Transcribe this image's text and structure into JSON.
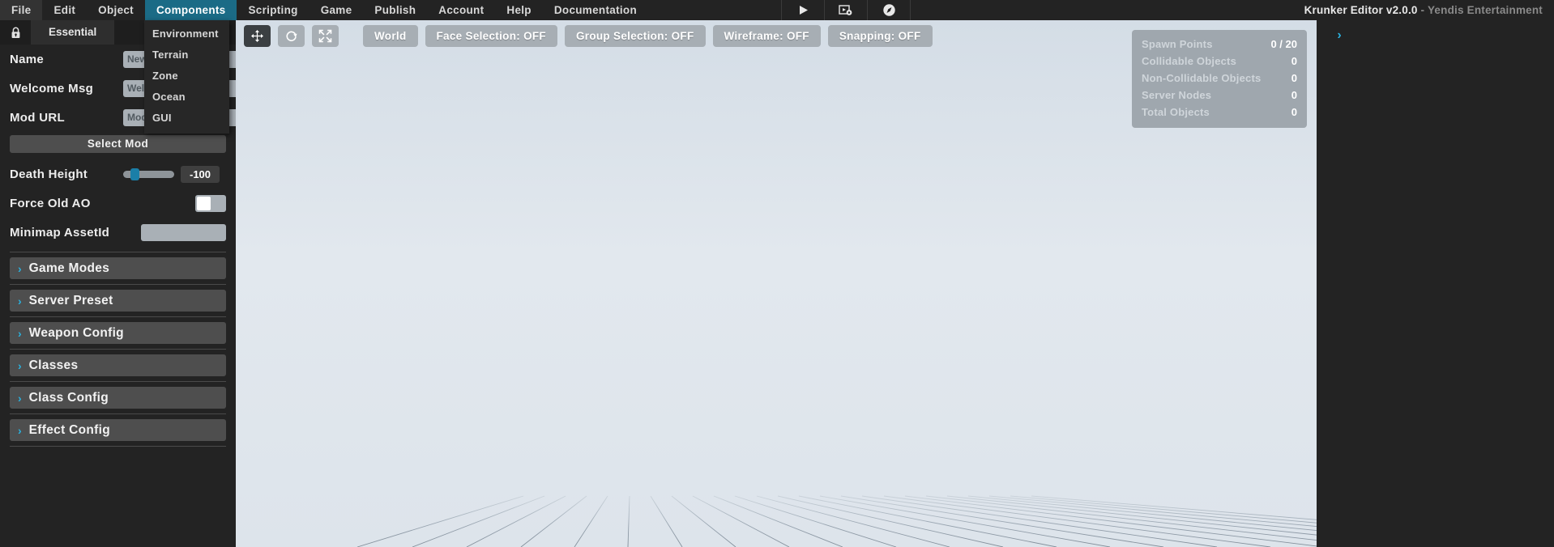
{
  "window": {
    "title": "Krunker Editor v2.0.0",
    "title_sub": " - Yendis Entertainment"
  },
  "menubar": {
    "items": [
      {
        "label": "File",
        "active": false
      },
      {
        "label": "Edit",
        "active": false
      },
      {
        "label": "Object",
        "active": false
      },
      {
        "label": "Components",
        "active": true
      },
      {
        "label": "Scripting",
        "active": false
      },
      {
        "label": "Game",
        "active": false
      },
      {
        "label": "Publish",
        "active": false
      },
      {
        "label": "Account",
        "active": false
      },
      {
        "label": "Help",
        "active": false
      },
      {
        "label": "Documentation",
        "active": false
      }
    ],
    "icons": [
      {
        "name": "play-icon",
        "title": "Play"
      },
      {
        "name": "record-settings-icon",
        "title": "Record Settings"
      },
      {
        "name": "compass-icon",
        "title": "Navigation"
      }
    ]
  },
  "dropdown": {
    "owner": "Components",
    "items": [
      {
        "label": "Environment"
      },
      {
        "label": "Terrain"
      },
      {
        "label": "Zone"
      },
      {
        "label": "Ocean"
      },
      {
        "label": "GUI"
      }
    ]
  },
  "left_panel": {
    "lock_icon": "lock-icon",
    "tab_label": "Essential",
    "fields": [
      {
        "label": "Name",
        "value": "",
        "placeholder": "New Map"
      },
      {
        "label": "Welcome Msg",
        "value": "",
        "placeholder": "Welcome"
      },
      {
        "label": "Mod URL",
        "value": "",
        "placeholder": "Mod URL"
      }
    ],
    "select_mod_label": "Select Mod",
    "death_height": {
      "label": "Death Height",
      "value": "-100",
      "slider_percent": 15
    },
    "force_old_ao": {
      "label": "Force Old AO",
      "enabled": false
    },
    "minimap_asset": {
      "label": "Minimap AssetId",
      "value": "",
      "placeholder": ""
    },
    "sections": [
      {
        "label": "Game Modes",
        "expanded": false
      },
      {
        "label": "Server Preset",
        "expanded": false
      },
      {
        "label": "Weapon Config",
        "expanded": false
      },
      {
        "label": "Classes",
        "expanded": false
      },
      {
        "label": "Class Config",
        "expanded": false
      },
      {
        "label": "Effect Config",
        "expanded": false
      }
    ]
  },
  "viewport_toolbar": {
    "transform_tools": [
      {
        "name": "move-tool",
        "icon": "move-icon",
        "active": true
      },
      {
        "name": "rotate-tool",
        "icon": "rotate-icon",
        "active": false
      },
      {
        "name": "scale-tool",
        "icon": "scale-icon",
        "active": false
      }
    ],
    "buttons": [
      {
        "label": "World"
      },
      {
        "label": "Face Selection: OFF"
      },
      {
        "label": "Group Selection: OFF"
      },
      {
        "label": "Wireframe: OFF"
      },
      {
        "label": "Snapping: OFF"
      }
    ]
  },
  "stats": {
    "rows": [
      {
        "label": "Spawn Points",
        "value": "0 / 20"
      },
      {
        "label": "Collidable Objects",
        "value": "0"
      },
      {
        "label": "Non-Collidable Objects",
        "value": "0"
      },
      {
        "label": "Server Nodes",
        "value": "0"
      },
      {
        "label": "Total Objects",
        "value": "0"
      }
    ]
  },
  "right_panel": {
    "expander_glyph": "›"
  },
  "colors": {
    "accent_cyan": "#2bb0dd",
    "menu_active": "#1b6b86",
    "panel_bg": "#232323",
    "viewport_bg": "#dde5ec",
    "control_gray": "#a7aeb4",
    "slider_blue": "#1b7fa8"
  }
}
